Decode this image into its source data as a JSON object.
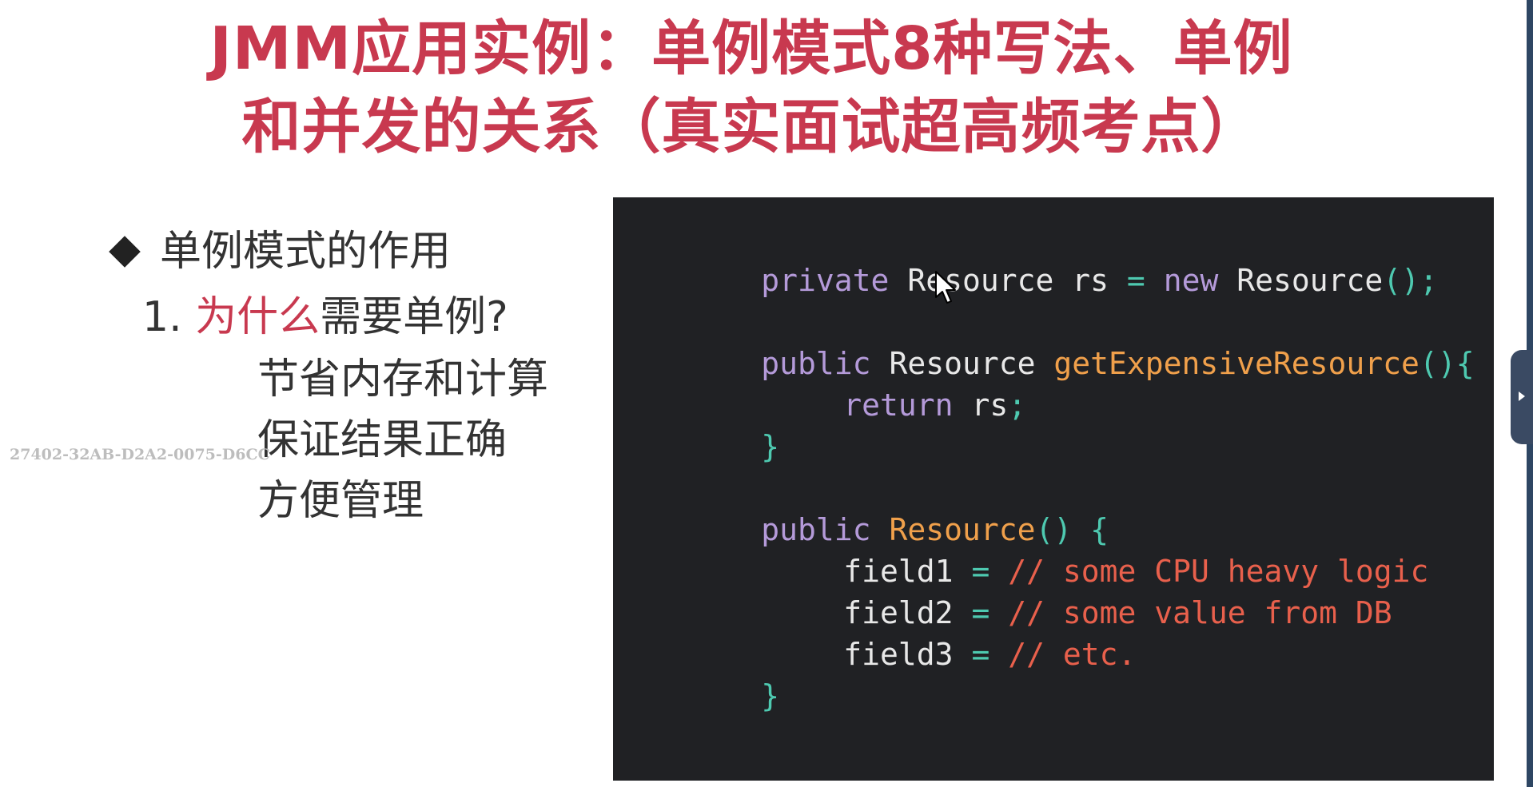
{
  "title": {
    "line1": "JMM应用实例：单例模式8种写法、单例",
    "line2": "和并发的关系（真实面试超高频考点）"
  },
  "content": {
    "bullet": "单例模式的作用",
    "numbered": {
      "number": "1.",
      "accent": "为什么",
      "rest": "需要单例?"
    },
    "sub_items": [
      "节省内存和计算",
      "保证结果正确",
      "方便管理"
    ]
  },
  "watermark": "27402-32AB-D2A2-0075-D6CC",
  "code": {
    "line1": {
      "kw": "private",
      "type": "Resource",
      "id": "rs",
      "eq": "=",
      "new": "new",
      "ctor": "Resource",
      "punct": "();"
    },
    "line3": {
      "kw": "public",
      "type": "Resource",
      "fn": "getExpensiveResource",
      "punct": "(){"
    },
    "line4": {
      "kw": "return",
      "id": "rs",
      "punct": ";"
    },
    "line5": {
      "brace": "}"
    },
    "line7": {
      "kw": "public",
      "fn": "Resource",
      "punct": "() {"
    },
    "line8": {
      "id": "field1",
      "eq": "=",
      "comment": "// some CPU heavy logic"
    },
    "line9": {
      "id": "field2",
      "eq": "=",
      "comment": "// some value from DB"
    },
    "line10": {
      "id": "field3",
      "eq": "=",
      "comment": "// etc."
    },
    "line11": {
      "brace": "}"
    }
  },
  "colors": {
    "title_accent": "#c8394f",
    "code_bg": "#202124",
    "keyword": "#b49ad9",
    "function": "#f0a04b",
    "comment": "#e8604c",
    "operator": "#4ec9b0"
  },
  "icons": {
    "cursor": "mouse-pointer-icon",
    "side_tab": "expand-arrow-icon"
  }
}
